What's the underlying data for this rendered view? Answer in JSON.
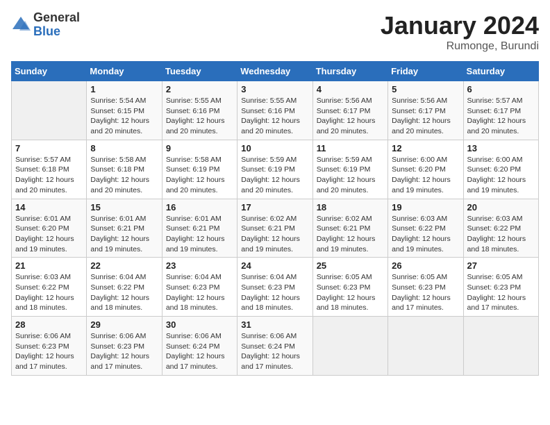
{
  "logo": {
    "general": "General",
    "blue": "Blue"
  },
  "header": {
    "title": "January 2024",
    "subtitle": "Rumonge, Burundi"
  },
  "weekdays": [
    "Sunday",
    "Monday",
    "Tuesday",
    "Wednesday",
    "Thursday",
    "Friday",
    "Saturday"
  ],
  "weeks": [
    [
      {
        "day": "",
        "info": ""
      },
      {
        "day": "1",
        "info": "Sunrise: 5:54 AM\nSunset: 6:15 PM\nDaylight: 12 hours and 20 minutes."
      },
      {
        "day": "2",
        "info": "Sunrise: 5:55 AM\nSunset: 6:16 PM\nDaylight: 12 hours and 20 minutes."
      },
      {
        "day": "3",
        "info": "Sunrise: 5:55 AM\nSunset: 6:16 PM\nDaylight: 12 hours and 20 minutes."
      },
      {
        "day": "4",
        "info": "Sunrise: 5:56 AM\nSunset: 6:17 PM\nDaylight: 12 hours and 20 minutes."
      },
      {
        "day": "5",
        "info": "Sunrise: 5:56 AM\nSunset: 6:17 PM\nDaylight: 12 hours and 20 minutes."
      },
      {
        "day": "6",
        "info": "Sunrise: 5:57 AM\nSunset: 6:17 PM\nDaylight: 12 hours and 20 minutes."
      }
    ],
    [
      {
        "day": "7",
        "info": "Sunrise: 5:57 AM\nSunset: 6:18 PM\nDaylight: 12 hours and 20 minutes."
      },
      {
        "day": "8",
        "info": "Sunrise: 5:58 AM\nSunset: 6:18 PM\nDaylight: 12 hours and 20 minutes."
      },
      {
        "day": "9",
        "info": "Sunrise: 5:58 AM\nSunset: 6:19 PM\nDaylight: 12 hours and 20 minutes."
      },
      {
        "day": "10",
        "info": "Sunrise: 5:59 AM\nSunset: 6:19 PM\nDaylight: 12 hours and 20 minutes."
      },
      {
        "day": "11",
        "info": "Sunrise: 5:59 AM\nSunset: 6:19 PM\nDaylight: 12 hours and 20 minutes."
      },
      {
        "day": "12",
        "info": "Sunrise: 6:00 AM\nSunset: 6:20 PM\nDaylight: 12 hours and 19 minutes."
      },
      {
        "day": "13",
        "info": "Sunrise: 6:00 AM\nSunset: 6:20 PM\nDaylight: 12 hours and 19 minutes."
      }
    ],
    [
      {
        "day": "14",
        "info": "Sunrise: 6:01 AM\nSunset: 6:20 PM\nDaylight: 12 hours and 19 minutes."
      },
      {
        "day": "15",
        "info": "Sunrise: 6:01 AM\nSunset: 6:21 PM\nDaylight: 12 hours and 19 minutes."
      },
      {
        "day": "16",
        "info": "Sunrise: 6:01 AM\nSunset: 6:21 PM\nDaylight: 12 hours and 19 minutes."
      },
      {
        "day": "17",
        "info": "Sunrise: 6:02 AM\nSunset: 6:21 PM\nDaylight: 12 hours and 19 minutes."
      },
      {
        "day": "18",
        "info": "Sunrise: 6:02 AM\nSunset: 6:21 PM\nDaylight: 12 hours and 19 minutes."
      },
      {
        "day": "19",
        "info": "Sunrise: 6:03 AM\nSunset: 6:22 PM\nDaylight: 12 hours and 19 minutes."
      },
      {
        "day": "20",
        "info": "Sunrise: 6:03 AM\nSunset: 6:22 PM\nDaylight: 12 hours and 18 minutes."
      }
    ],
    [
      {
        "day": "21",
        "info": "Sunrise: 6:03 AM\nSunset: 6:22 PM\nDaylight: 12 hours and 18 minutes."
      },
      {
        "day": "22",
        "info": "Sunrise: 6:04 AM\nSunset: 6:22 PM\nDaylight: 12 hours and 18 minutes."
      },
      {
        "day": "23",
        "info": "Sunrise: 6:04 AM\nSunset: 6:23 PM\nDaylight: 12 hours and 18 minutes."
      },
      {
        "day": "24",
        "info": "Sunrise: 6:04 AM\nSunset: 6:23 PM\nDaylight: 12 hours and 18 minutes."
      },
      {
        "day": "25",
        "info": "Sunrise: 6:05 AM\nSunset: 6:23 PM\nDaylight: 12 hours and 18 minutes."
      },
      {
        "day": "26",
        "info": "Sunrise: 6:05 AM\nSunset: 6:23 PM\nDaylight: 12 hours and 17 minutes."
      },
      {
        "day": "27",
        "info": "Sunrise: 6:05 AM\nSunset: 6:23 PM\nDaylight: 12 hours and 17 minutes."
      }
    ],
    [
      {
        "day": "28",
        "info": "Sunrise: 6:06 AM\nSunset: 6:23 PM\nDaylight: 12 hours and 17 minutes."
      },
      {
        "day": "29",
        "info": "Sunrise: 6:06 AM\nSunset: 6:23 PM\nDaylight: 12 hours and 17 minutes."
      },
      {
        "day": "30",
        "info": "Sunrise: 6:06 AM\nSunset: 6:24 PM\nDaylight: 12 hours and 17 minutes."
      },
      {
        "day": "31",
        "info": "Sunrise: 6:06 AM\nSunset: 6:24 PM\nDaylight: 12 hours and 17 minutes."
      },
      {
        "day": "",
        "info": ""
      },
      {
        "day": "",
        "info": ""
      },
      {
        "day": "",
        "info": ""
      }
    ]
  ]
}
